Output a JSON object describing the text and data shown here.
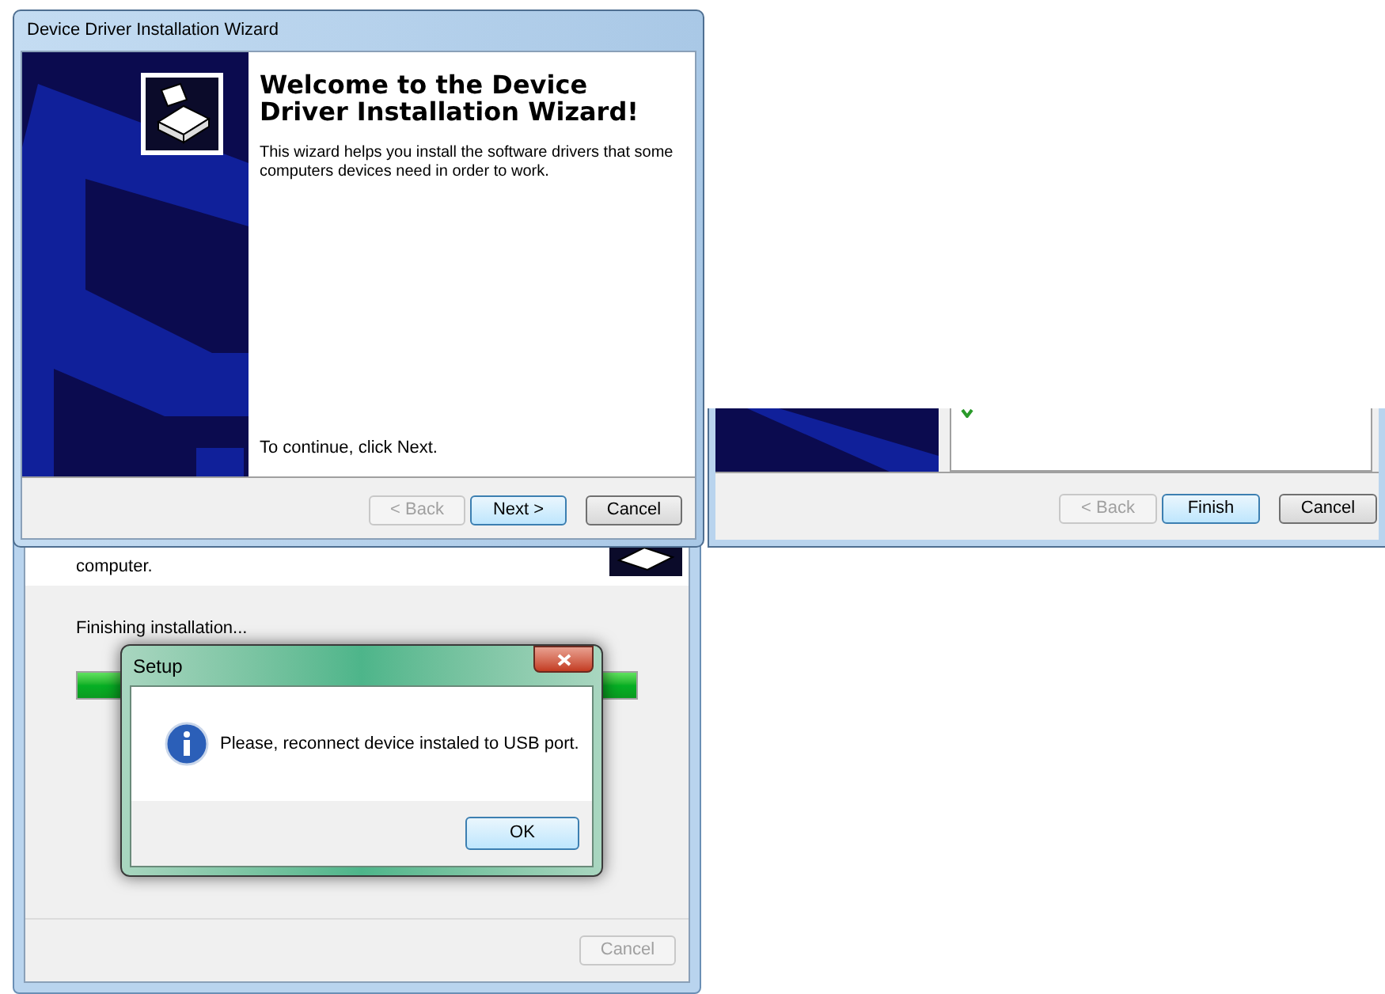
{
  "wizard": {
    "title": "Device Driver Installation Wizard",
    "heading": "Welcome to the Device Driver Installation Wizard!",
    "description": "This wizard helps you install the software drivers that some computers devices need in order to work.",
    "hint": "To continue, click Next.",
    "buttons": [
      {
        "label": "< Back",
        "disabled": true
      },
      {
        "label": "Next >",
        "disabled": false,
        "default": true
      },
      {
        "label": "Cancel",
        "disabled": false,
        "default": false
      }
    ]
  },
  "finish_window": {
    "buttons": [
      {
        "label": "< Back",
        "disabled": true
      },
      {
        "label": "Finish",
        "disabled": false,
        "default": true
      },
      {
        "label": "Cancel",
        "disabled": false,
        "default": false
      }
    ]
  },
  "setup_window": {
    "description": "computer.",
    "status": "Finishing installation...",
    "progress": {
      "level": 1
    },
    "buttons": [
      {
        "label": "Cancel",
        "disabled": true
      }
    ]
  },
  "dialog": {
    "title": "Setup",
    "message": "Please, reconnect device instaled to USB port.",
    "buttons": [
      {
        "label": "OK",
        "disabled": false,
        "default": true
      }
    ]
  }
}
